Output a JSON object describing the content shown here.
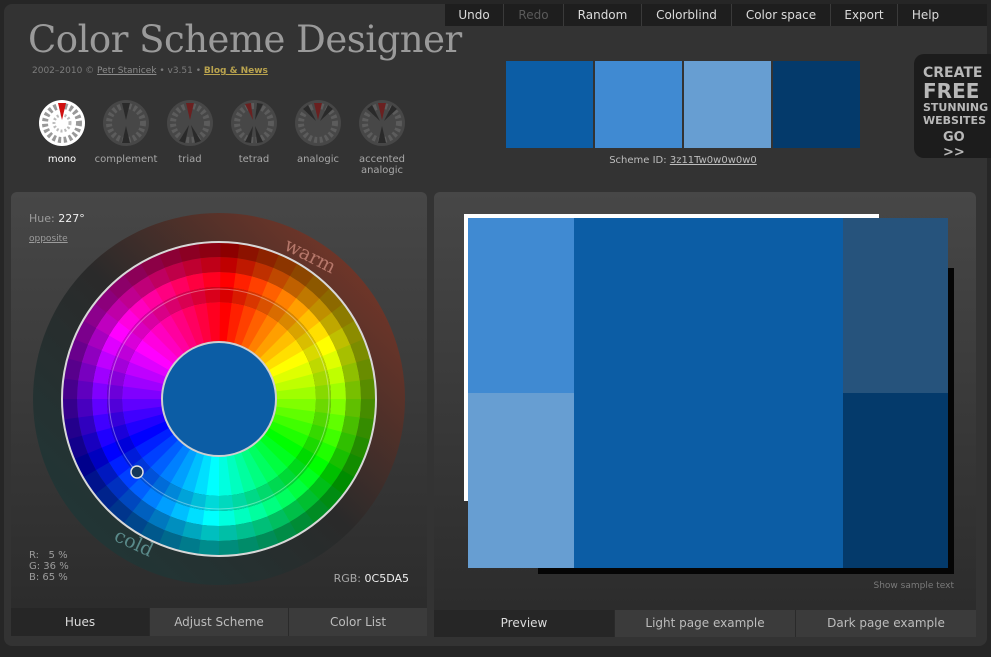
{
  "header": {
    "title": "Color Scheme Designer",
    "years": "2002–2010 ©",
    "author": "Petr Stanicek",
    "version": "• v3.51 •",
    "blog": "Blog & News"
  },
  "menu": [
    {
      "label": "Undo",
      "enabled": true
    },
    {
      "label": "Redo",
      "enabled": false
    },
    {
      "label": "Random",
      "enabled": true
    },
    {
      "label": "Colorblind",
      "enabled": true
    },
    {
      "label": "Color space",
      "enabled": true
    },
    {
      "label": "Export",
      "enabled": true
    },
    {
      "label": "Help",
      "enabled": true
    }
  ],
  "scheme_types": [
    {
      "label": "mono",
      "active": true
    },
    {
      "label": "complement",
      "active": false
    },
    {
      "label": "triad",
      "active": false
    },
    {
      "label": "tetrad",
      "active": false
    },
    {
      "label": "analogic",
      "active": false
    },
    {
      "label": "accented analogic",
      "active": false
    }
  ],
  "swatches": [
    "#0C5DA5",
    "#408AD2",
    "#679ED2",
    "#043A6B"
  ],
  "scheme_id": {
    "label": "Scheme ID:",
    "value": "3z11Tw0w0w0w0"
  },
  "ad": {
    "line1": "CREATE",
    "line2": "FREE",
    "line3": "STUNNING",
    "line4": "WEBSITES",
    "go": "GO >>"
  },
  "wheel": {
    "hue_label": "Hue:",
    "hue_value": "227°",
    "opposite": "opposite",
    "warm": "warm",
    "cold": "cold",
    "center_color": "#0C5DA5"
  },
  "rgb_percent": {
    "r": "R:   5 %",
    "g": "G: 36 %",
    "b": "B: 65 %"
  },
  "rgb_hex": {
    "label": "RGB:",
    "value": "0C5DA5"
  },
  "left_tabs": [
    "Hues",
    "Adjust Scheme",
    "Color List"
  ],
  "preview": {
    "colors": {
      "primary": "#0C5DA5",
      "light": "#408AD2",
      "pale": "#679ED2",
      "dark_mid": "#26537C",
      "darkest": "#043A6B"
    },
    "sample_text": "Show sample text"
  },
  "right_tabs": [
    "Preview",
    "Light page example",
    "Dark page example"
  ]
}
